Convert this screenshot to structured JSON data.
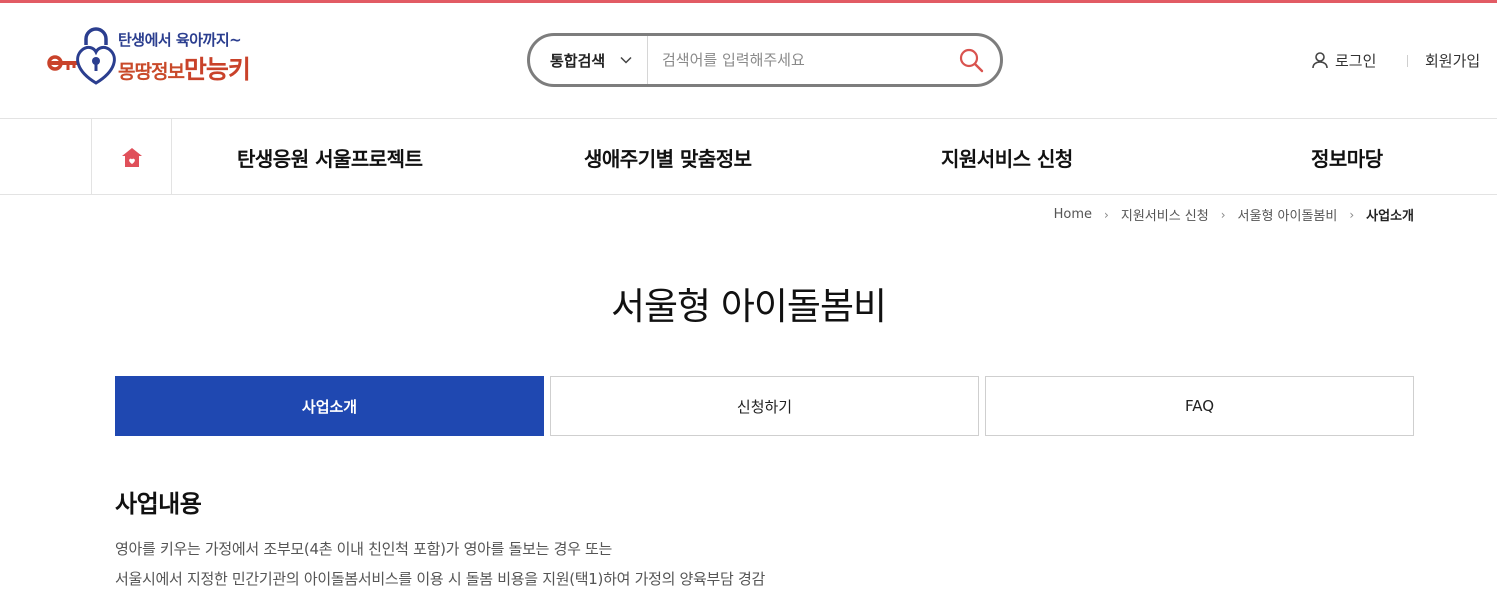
{
  "logo": {
    "line1": "탄생에서 육아까지~",
    "line2_a": "몽땅정보",
    "line2_b": "만능키"
  },
  "search": {
    "scope_label": "통합검색",
    "placeholder": "검색어를 입력해주세요",
    "value": ""
  },
  "util": {
    "login": "로그인",
    "join": "회원가입"
  },
  "gnb": {
    "items": [
      "탄생응원 서울프로젝트",
      "생애주기별 맞춤정보",
      "지원서비스 신청",
      "정보마당"
    ]
  },
  "breadcrumb": [
    "Home",
    "지원서비스 신청",
    "서울형 아이돌봄비",
    "사업소개"
  ],
  "page_title": "서울형 아이돌봄비",
  "tabs": [
    {
      "label": "사업소개",
      "active": true
    },
    {
      "label": "신청하기",
      "active": false
    },
    {
      "label": "FAQ",
      "active": false
    }
  ],
  "section": {
    "title": "사업내용",
    "lines": [
      "영아를 키우는 가정에서 조부모(4촌 이내 친인척 포함)가 영아를 돌보는 경우 또는",
      "서울시에서 지정한 민간기관의  아이돌봄서비스를 이용 시 돌봄 비용을 지원(택1)하여 가정의 양육부담 경감"
    ]
  },
  "colors": {
    "accent_top_line": "#e25b64",
    "active_tab": "#1f48b1",
    "search_icon": "#d9534f",
    "home_icon": "#e0505a"
  },
  "icons": {
    "logo": "heart-lock-key-logo",
    "scope_toggle": "chevron-down-icon",
    "search": "search-icon",
    "user": "user-icon",
    "home": "home-icon",
    "breadcrumb_separator": "chevron-right-icon"
  }
}
